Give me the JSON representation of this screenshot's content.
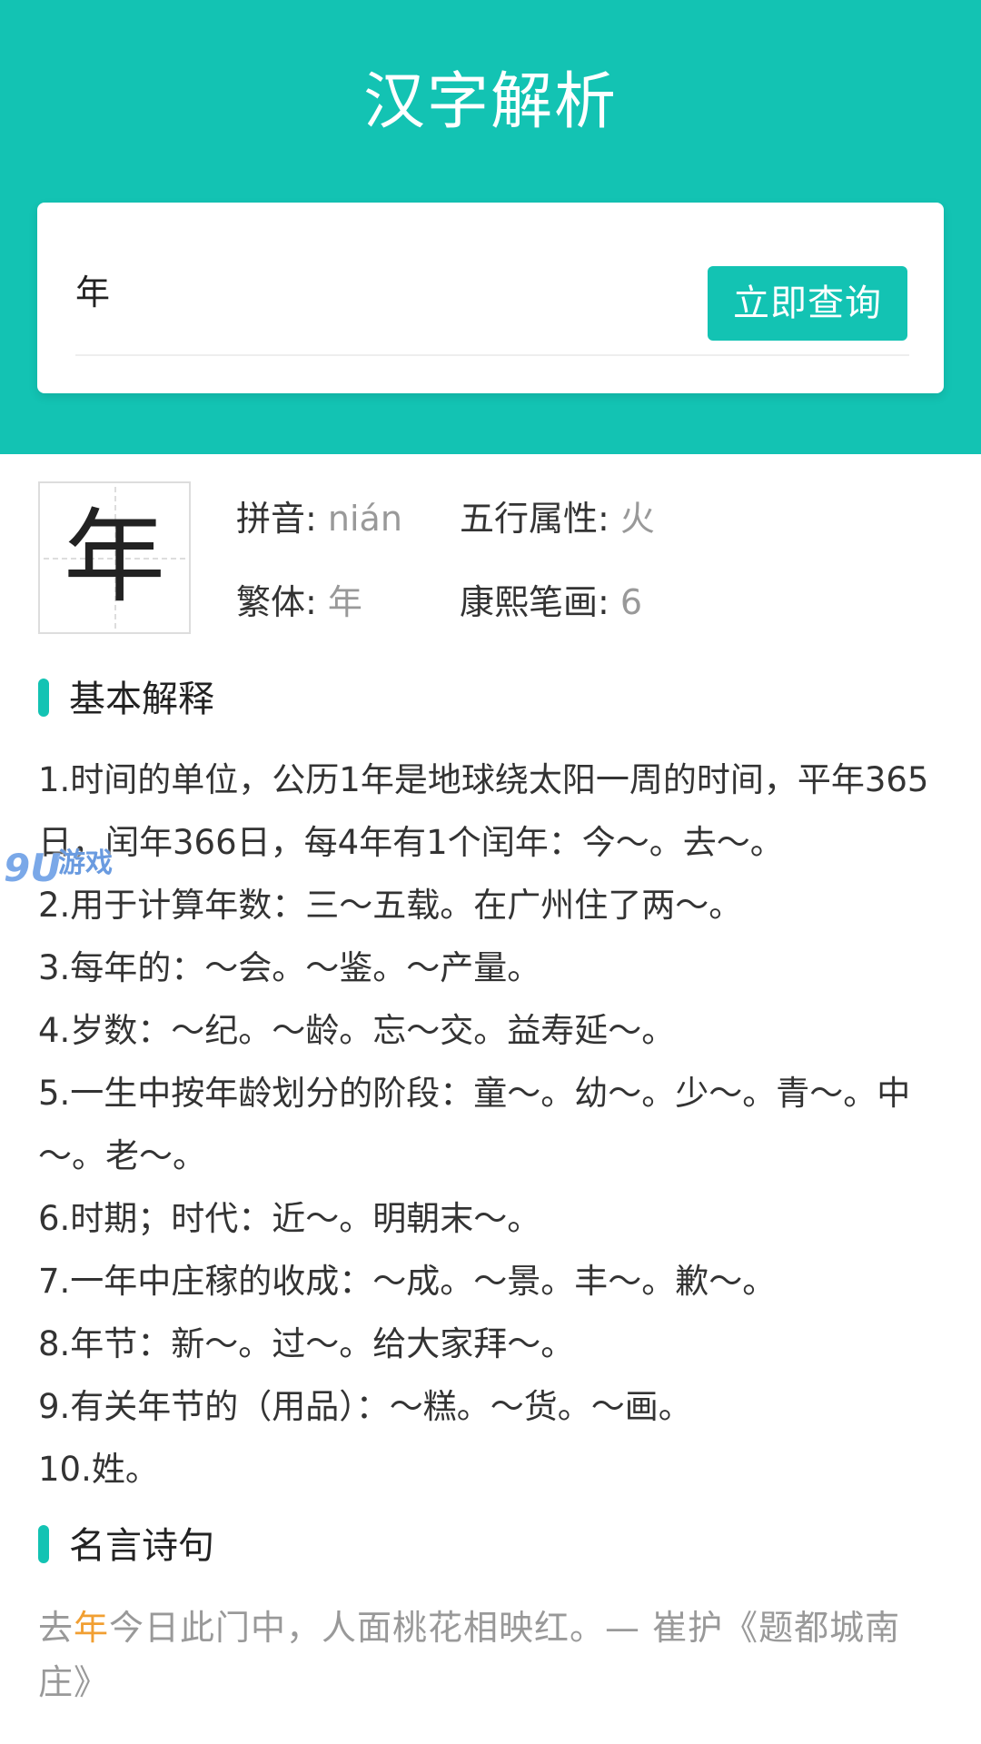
{
  "header": {
    "title": "汉字解析"
  },
  "search": {
    "value": "年",
    "button_label": "立即查询"
  },
  "character": {
    "glyph": "年",
    "pinyin_label": "拼音:",
    "pinyin_value": "nián",
    "wuxing_label": "五行属性:",
    "wuxing_value": "火",
    "traditional_label": "繁体:",
    "traditional_value": "年",
    "kangxi_label": "康熙笔画:",
    "kangxi_value": "6"
  },
  "basic": {
    "title": "基本解释",
    "items": [
      "1.时间的单位，公历1年是地球绕太阳一周的时间，平年365日，闰年366日，每4年有1个闰年：今～。去～。",
      "2.用于计算年数：三～五载。在广州住了两～。",
      "3.每年的：～会。～鉴。～产量。",
      "4.岁数：～纪。～龄。忘～交。益寿延～。",
      "5.一生中按年龄划分的阶段：童～。幼～。少～。青～。中～。老～。",
      "6.时期；时代：近～。明朝末～。",
      "7.一年中庄稼的收成：～成。～景。丰～。歉～。",
      "8.年节：新～。过～。给大家拜～。",
      "9.有关年节的（用品）：～糕。～货。～画。",
      "10.姓。"
    ]
  },
  "quotes": {
    "title": "名言诗句",
    "items": [
      {
        "before": "去",
        "highlight": "年",
        "after": "今日此门中，人面桃花相映红。— 崔护《题都城南庄》"
      }
    ]
  },
  "watermark": {
    "num": "9U",
    "text": "游戏"
  },
  "colors": {
    "brand": "#13c3b3",
    "highlight": "#f19f32",
    "muted": "#999999"
  }
}
